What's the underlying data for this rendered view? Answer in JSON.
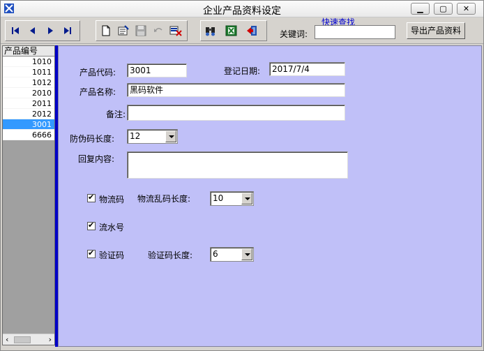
{
  "window": {
    "title": "企业产品资料设定"
  },
  "toolbar": {
    "quick_find_link": "快速查找",
    "keyword_label": "关键词:",
    "keyword_value": "",
    "export_button": "导出产品资料"
  },
  "list": {
    "header": "产品编号",
    "rows": [
      "1010",
      "1011",
      "1012",
      "2010",
      "2011",
      "2012",
      "3001",
      "6666"
    ],
    "selected": "3001"
  },
  "form": {
    "product_code_label": "产品代码:",
    "product_code_value": "3001",
    "register_date_label": "登记日期:",
    "register_date_value": "2017/7/4",
    "product_name_label": "产品名称:",
    "product_name_value": "黑码软件",
    "note_label": "备注:",
    "note_value": "",
    "anticounterfeit_len_label": "防伪码长度:",
    "anticounterfeit_len_value": "12",
    "reply_label": "回复内容:",
    "reply_value": "",
    "logistics_code_label": "物流码",
    "logistics_code_checked": true,
    "logistics_len_label": "物流乱码长度:",
    "logistics_len_value": "10",
    "serial_label": "流水号",
    "serial_checked": true,
    "verify_code_label": "验证码",
    "verify_code_checked": true,
    "verify_len_label": "验证码长度:",
    "verify_len_value": "6"
  },
  "colors": {
    "panel_bg": "#c0c0f8",
    "divider": "#0000c8",
    "selection": "#3399ff",
    "link": "#0000d0"
  }
}
